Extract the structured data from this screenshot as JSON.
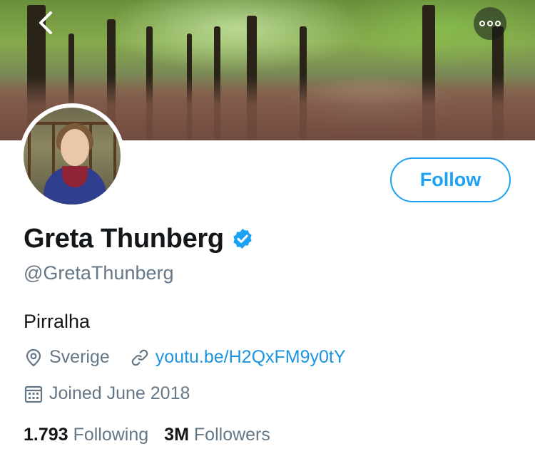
{
  "header": {
    "back_icon": "chevron-left-icon",
    "more_icon": "more-options-icon"
  },
  "profile": {
    "name": "Greta Thunberg",
    "verified_icon": "verified-badge-icon",
    "handle": "@GretaThunberg",
    "bio": "Pirralha",
    "location": "Sverige",
    "location_icon": "location-pin-icon",
    "website": "youtu.be/H2QxFM9y0tY",
    "website_icon": "link-icon",
    "joined": "Joined June 2018",
    "joined_icon": "calendar-icon",
    "follow_label": "Follow"
  },
  "stats": {
    "following_count": "1.793",
    "following_label": "Following",
    "followers_count": "3M",
    "followers_label": "Followers"
  },
  "colors": {
    "accent": "#1da1f2",
    "link": "#1b95e0",
    "secondary_text": "#657786",
    "primary_text": "#14171a"
  }
}
